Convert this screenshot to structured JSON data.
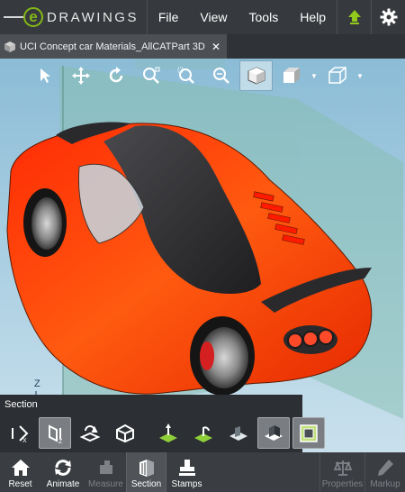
{
  "app": {
    "logo_text": "DRAWINGS",
    "logo_letter": "e"
  },
  "menu": [
    "File",
    "View",
    "Tools",
    "Help"
  ],
  "top_icons": [
    "upload-icon",
    "gear-icon"
  ],
  "document_tab": {
    "label": "UCI Concept car Materials_AllCATPart 3D X...",
    "close_glyph": "✕"
  },
  "view_toolbar": [
    {
      "name": "select-icon",
      "active": false
    },
    {
      "name": "pan-icon",
      "active": false
    },
    {
      "name": "rotate-icon",
      "active": false
    },
    {
      "name": "zoom-fit-icon",
      "active": false
    },
    {
      "name": "zoom-area-icon",
      "active": false
    },
    {
      "name": "zoom-icon",
      "active": false
    },
    {
      "name": "shaded-view-icon",
      "active": true
    },
    {
      "name": "display-style-icon",
      "active": false,
      "dropdown": true
    },
    {
      "name": "standard-views-icon",
      "active": false,
      "dropdown": true
    }
  ],
  "axis_label": "Z",
  "section": {
    "title": "Section",
    "tools": [
      {
        "name": "section-x-icon",
        "active": false
      },
      {
        "name": "section-z-icon",
        "active": true
      },
      {
        "name": "flip-section-icon",
        "active": false
      },
      {
        "name": "section-cap-icon",
        "active": false
      },
      {
        "name": "plane-up-icon",
        "active": false
      },
      {
        "name": "plane-rotate-icon",
        "active": false
      },
      {
        "name": "show-plane-icon",
        "active": false
      },
      {
        "name": "section-view-icon",
        "active": true
      },
      {
        "name": "section-box-icon",
        "active": true
      }
    ]
  },
  "bottom_bar": {
    "left": [
      {
        "label": "Reset",
        "icon": "home-icon",
        "enabled": true
      },
      {
        "label": "Animate",
        "icon": "animate-icon",
        "enabled": true
      },
      {
        "label": "Measure",
        "icon": "measure-icon",
        "enabled": false
      },
      {
        "label": "Section",
        "icon": "section-icon",
        "enabled": true,
        "selected": true
      },
      {
        "label": "Stamps",
        "icon": "stamp-icon",
        "enabled": true
      }
    ],
    "right": [
      {
        "label": "Properties",
        "icon": "scales-icon",
        "enabled": false
      },
      {
        "label": "Markup",
        "icon": "pencil-icon",
        "enabled": false
      }
    ]
  },
  "colors": {
    "accent": "#84b818",
    "car_body": "#ff4a0a",
    "car_roof": "#2f2f32",
    "section_plane": "#8fc3b8"
  }
}
